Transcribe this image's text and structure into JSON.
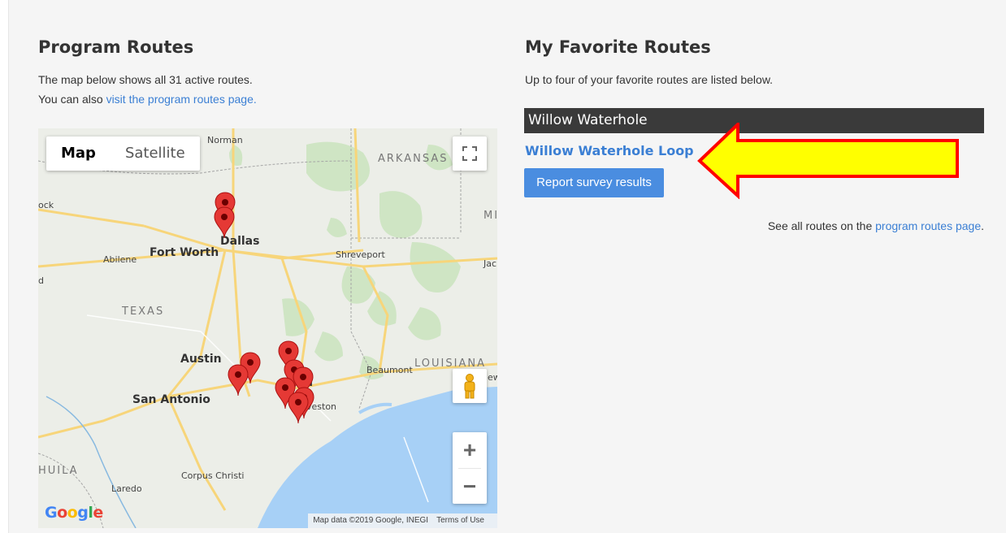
{
  "left": {
    "title": "Program Routes",
    "line1": "The map below shows all 31 active routes.",
    "line2_prefix": "You can also ",
    "line2_link": "visit the program routes page."
  },
  "map": {
    "type_map": "Map",
    "type_satellite": "Satellite",
    "google": "Google",
    "attribution": "Map data ©2019 Google, INEGI",
    "terms": "Terms of Use",
    "zoom_in": "+",
    "zoom_out": "−",
    "labels": {
      "norman": "Norman",
      "arkansas": "ARKANSAS",
      "ock": "ock",
      "mi": "MI",
      "dallas": "Dallas",
      "fort_worth": "Fort Worth",
      "abilene": "Abilene",
      "shreveport": "Shreveport",
      "jac": "Jac",
      "texas": "TEXAS",
      "austin": "Austin",
      "louisiana": "LOUISIANA",
      "beaumont": "Beaumont",
      "ew": "ew",
      "houston": "n",
      "san_antonio": "San Antonio",
      "galveston": "veston",
      "huila": "HUILA",
      "corpus": "Corpus Christi",
      "laredo": "Laredo",
      "d": "d"
    },
    "icons": {
      "fullscreen": "fullscreen-icon",
      "pegman": "pegman-icon",
      "pin": "map-pin-icon"
    }
  },
  "right": {
    "title": "My Favorite Routes",
    "subtitle": "Up to four of your favorite routes are listed below.",
    "route_name": "Willow Waterhole",
    "route_link": "Willow Waterhole Loop",
    "report_button": "Report survey results",
    "see_all_prefix": "See all routes on the ",
    "see_all_link": "program routes page",
    "see_all_suffix": "."
  },
  "colors": {
    "link": "#3b7fd4",
    "button": "#4a8de0",
    "route_bar": "#3a3a3a",
    "arrow_fill": "#ffff00",
    "arrow_stroke": "#ff0000",
    "pin": "#e53935"
  }
}
